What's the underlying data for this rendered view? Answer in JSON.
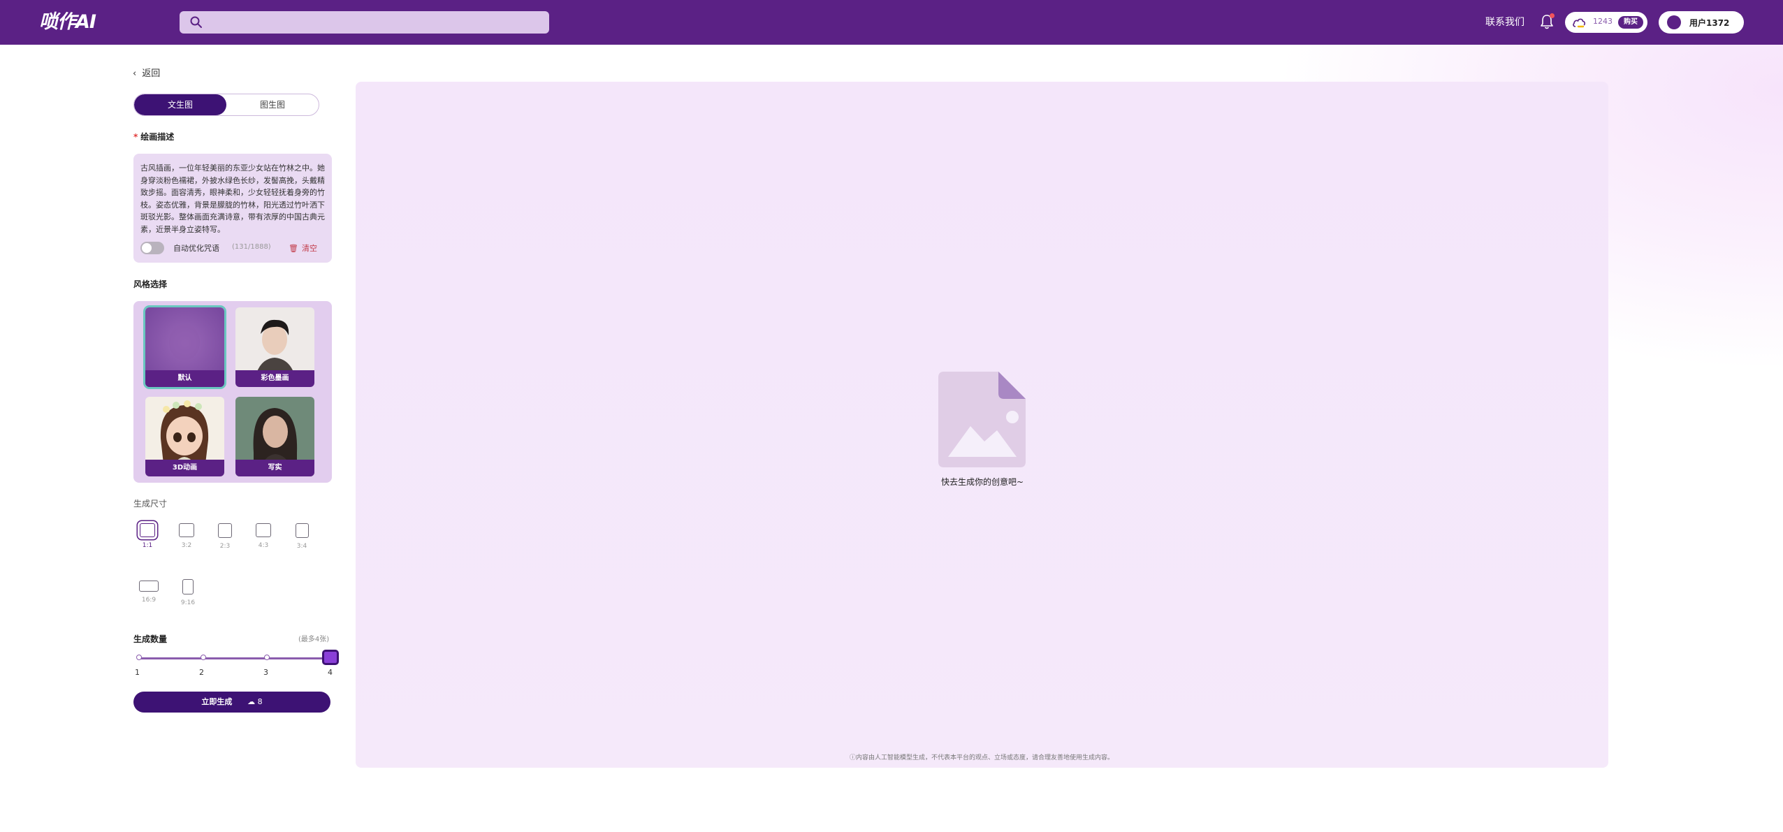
{
  "header": {
    "logo": "唢作AI",
    "search_placeholder": "",
    "contact": "联系我们",
    "credits": "1243",
    "buy": "购买",
    "username": "用户1372"
  },
  "sidebar": {
    "back": "返回",
    "tabs": [
      "文生图",
      "图生图"
    ],
    "prompt_label": "绘画描述",
    "prompt_text": "古风插画，一位年轻美丽的东亚少女站在竹林之中。她身穿淡粉色襦裙，外披水绿色长纱，发髻高挽，头戴精致步摇。面容清秀，眼神柔和，少女轻轻抚着身旁的竹枝。姿态优雅，背景是朦胧的竹林，阳光透过竹叶洒下斑驳光影。整体画面充满诗意，带有浓厚的中国古典元素，近景半身立姿特写。",
    "auto_optimize": "自动优化咒语",
    "counter": "(131/1888)",
    "clear": "清空",
    "style_label": "风格选择",
    "styles": [
      "默认",
      "彩色墨画",
      "3D动画",
      "写实"
    ],
    "size_label": "生成尺寸",
    "sizes": [
      "1:1",
      "3:2",
      "2:3",
      "4:3",
      "3:4",
      "16:9",
      "9:16"
    ],
    "count_label": "生成数量",
    "count_max": "(最多4张)",
    "count_ticks": [
      "1",
      "2",
      "3",
      "4"
    ],
    "count_value": 4,
    "generate": "立即生成",
    "generate_cost": "8"
  },
  "main": {
    "empty_text": "快去生成你的创意吧~",
    "disclaimer": "ⓘ内容由人工智能模型生成，不代表本平台的观点、立场或态度，请合理友善地使用生成内容。"
  },
  "colors": {
    "brand": "#5b2185",
    "brand_dark": "#3d1274",
    "selected_outline": "#6ac7c0"
  }
}
